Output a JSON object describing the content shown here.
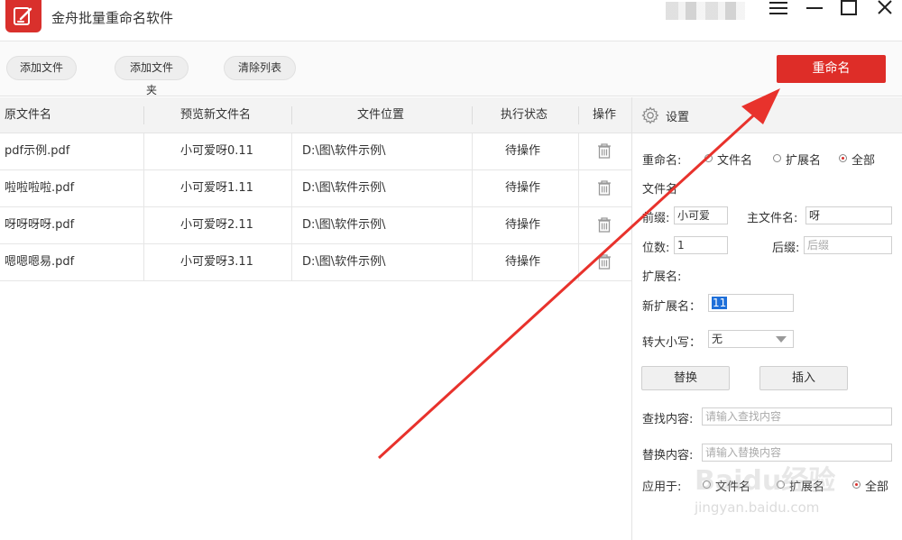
{
  "window": {
    "title": "金舟批量重命名软件"
  },
  "toolbar": {
    "add_file": "添加文件",
    "add_folder": "添加文件夹",
    "clear_list": "清除列表",
    "rename": "重命名"
  },
  "table": {
    "headers": [
      "原文件名",
      "预览新文件名",
      "文件位置",
      "执行状态",
      "操作"
    ],
    "rows": [
      {
        "original": "pdf示例.pdf",
        "preview": "小可爱呀0.11",
        "location": "D:\\图\\软件示例\\",
        "status": "待操作"
      },
      {
        "original": "啦啦啦啦.pdf",
        "preview": "小可爱呀1.11",
        "location": "D:\\图\\软件示例\\",
        "status": "待操作"
      },
      {
        "original": "呀呀呀呀.pdf",
        "preview": "小可爱呀2.11",
        "location": "D:\\图\\软件示例\\",
        "status": "待操作"
      },
      {
        "original": "嗯嗯嗯易.pdf",
        "preview": "小可爱呀3.11",
        "location": "D:\\图\\软件示例\\",
        "status": "待操作"
      }
    ]
  },
  "settings": {
    "title": "设置",
    "rename_label": "重命名:",
    "opt_filename": "文件名",
    "opt_extension": "扩展名",
    "opt_all": "全部",
    "filename_section": "文件名",
    "prefix_label": "前缀:",
    "prefix_value": "小可爱",
    "main_name_label": "主文件名:",
    "main_name_value": "呀",
    "digits_label": "位数:",
    "digits_value": "1",
    "suffix_label": "后缀:",
    "suffix_placeholder": "后缀",
    "extension_section": "扩展名:",
    "new_ext_label": "新扩展名：",
    "new_ext_value": "11",
    "case_label": "转大小写：",
    "case_value": "无",
    "replace_btn": "替换",
    "insert_btn": "插入",
    "find_label": "查找内容:",
    "find_placeholder": "请输入查找内容",
    "replace_label": "替换内容:",
    "replace_placeholder": "请输入替换内容",
    "apply_label": "应用于:",
    "apply_filename": "文件名",
    "apply_extension": "扩展名",
    "apply_all": "全部"
  },
  "watermark": {
    "brand": "Baidu经验",
    "url": "jingyan.baidu.com"
  },
  "colors": {
    "accent": "#de2d28",
    "arrow": "#e8322c",
    "selection": "#1e6fd9"
  }
}
